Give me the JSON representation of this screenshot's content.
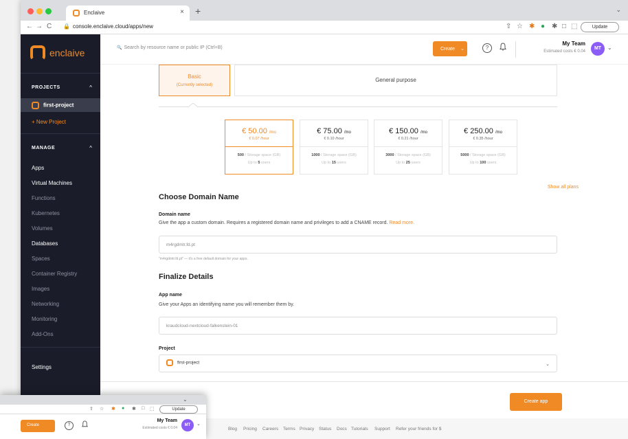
{
  "browser": {
    "tab_title": "Enclaive",
    "tab_close": "×",
    "new_tab": "+",
    "window_chevron": "⌄",
    "back": "←",
    "forward": "→",
    "reload": "C",
    "lock": "🔒",
    "url": "console.enclaive.cloud/apps/new",
    "update_label": "Update",
    "ext_icons": [
      "⇧",
      "☆",
      "✱",
      "●",
      "✱",
      "□",
      "⬚"
    ]
  },
  "sidebar": {
    "brand": "enclaive",
    "projects_header": "PROJECTS",
    "caret": "^",
    "active_project": "first-project",
    "new_project": "+ New Project",
    "manage_header": "MANAGE",
    "items": [
      {
        "label": "Apps",
        "bright": true
      },
      {
        "label": "Virtual Machines",
        "bright": true
      },
      {
        "label": "Functions",
        "bright": false
      },
      {
        "label": "Kubernetes",
        "bright": false
      },
      {
        "label": "Volumes",
        "bright": false
      },
      {
        "label": "Databases",
        "bright": true
      },
      {
        "label": "Spaces",
        "bright": false
      },
      {
        "label": "Container Registry",
        "bright": false
      },
      {
        "label": "Images",
        "bright": false
      },
      {
        "label": "Networking",
        "bright": false
      },
      {
        "label": "Monitoring",
        "bright": false
      },
      {
        "label": "Add-Ons",
        "bright": false
      }
    ],
    "settings": "Settings"
  },
  "topbar": {
    "search_placeholder": "Search by resource name or public IP (Ctrl+B)",
    "search_icon": "🔍",
    "create_label": "Create",
    "create_caret": "⌄",
    "help": "?",
    "bell": "🔔",
    "team_name": "My Team",
    "estimated_costs": "Estimated costs € 0.04",
    "avatar": "MT",
    "avatar_caret": "⌄"
  },
  "plans": {
    "basic_title": "Basic",
    "basic_sub": "(Currently selected)",
    "general": "General purpose"
  },
  "prices": [
    {
      "amount": "€ 50.00",
      "per": "/mo",
      "hourly": "€ 0.07 /hour",
      "storage_num": "500",
      "storage_txt": " / Storage space (GB)",
      "users_pre": "Up to ",
      "users_num": "5",
      "users_post": " users",
      "selected": true
    },
    {
      "amount": "€ 75.00",
      "per": "/mo",
      "hourly": "€ 0.10 /hour",
      "storage_num": "1000",
      "storage_txt": " / Storage space (GB)",
      "users_pre": "Up to ",
      "users_num": "15",
      "users_post": " users",
      "selected": false
    },
    {
      "amount": "€ 150.00",
      "per": "/mo",
      "hourly": "€ 0.21 /hour",
      "storage_num": "3000",
      "storage_txt": " / Storage space (GB)",
      "users_pre": "Up to ",
      "users_num": "25",
      "users_post": " users",
      "selected": false
    },
    {
      "amount": "€ 250.00",
      "per": "/mo",
      "hourly": "€ 0.35 /hour",
      "storage_num": "5000",
      "storage_txt": " / Storage space (GB)",
      "users_pre": "Up to ",
      "users_num": "100",
      "users_post": " users",
      "selected": false
    }
  ],
  "show_all_plans": "Show all plans",
  "domain": {
    "heading": "Choose Domain Name",
    "label": "Domain name",
    "desc": "Give the app a custom domain. Requires a registered domain name and privileges to add a CNAME record.",
    "read_more": "Read more.",
    "value": "m4rgdmtr.fd.pt",
    "hint": "\"m4rgdmtr.fd.pt\" — it's a free default domain for your apps."
  },
  "finalize": {
    "heading": "Finalize Details",
    "app_label": "App name",
    "app_desc": "Give your Apps an identifying name you will remember them by.",
    "app_value": "kraudcloud-nextcloud-falkenstein-01",
    "project_label": "Project",
    "project_value": "first-project",
    "project_caret": "⌄"
  },
  "create_app": "Create app",
  "footer_links": [
    "Blog",
    "Pricing",
    "Careers",
    "Terms",
    "Privacy",
    "Status",
    "Docs",
    "Tutorials",
    "Support",
    "Refer your friends for $"
  ],
  "colors": {
    "accent": "#f08a24",
    "sidebar": "#1a1d29"
  }
}
